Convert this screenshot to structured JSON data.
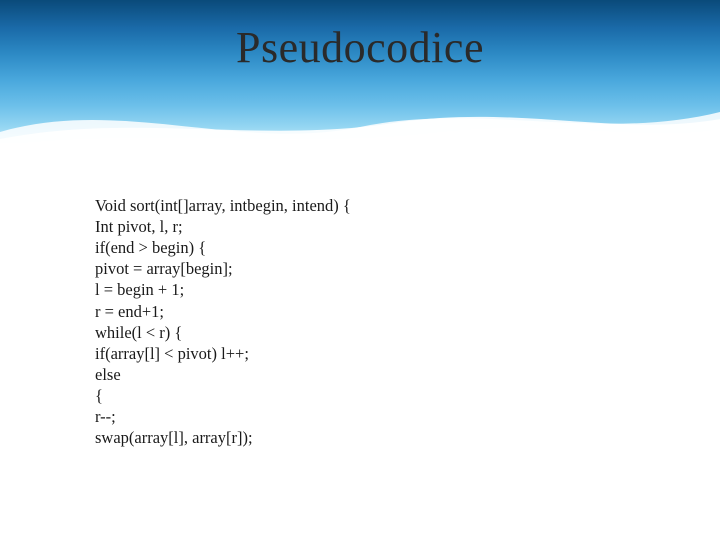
{
  "title": "Pseudocodice",
  "code": {
    "l0": "Void sort(int[]array, intbegin, intend) {",
    "l1": "Int pivot, l, r;",
    "l2": "if(end > begin) {",
    "l3": "pivot = array[begin];",
    "l4": "l = begin + 1;",
    "l5": "r = end+1;",
    "l6": "while(l < r) {",
    "l7": "if(array[l] < pivot) l++;",
    "l8": "else",
    "l9": "{",
    "l10": "r--;",
    "l11": "swap(array[l], array[r]);"
  }
}
